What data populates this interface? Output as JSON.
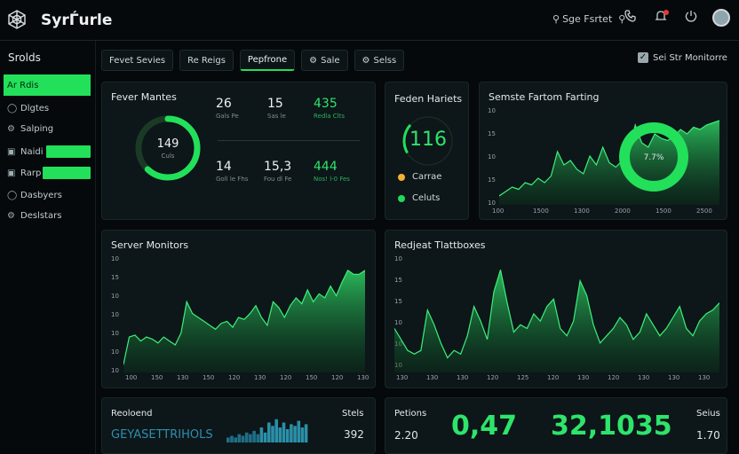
{
  "app": {
    "title": "SyrЃurle"
  },
  "search": {
    "label": "Sge Fsrtet"
  },
  "top_icons": [
    "search-icon",
    "phone-icon",
    "notification-icon",
    "power-icon",
    "avatar"
  ],
  "sidebar": {
    "title": "Srolds",
    "items": [
      {
        "label": "Ar Rdis",
        "icon": "",
        "active": true
      },
      {
        "label": "Dlgtes",
        "icon": "user-icon"
      },
      {
        "label": "Salping",
        "icon": "gear-icon"
      },
      {
        "label": "Naidi",
        "icon": "folder-icon"
      },
      {
        "label": "Rarp",
        "icon": "folder-icon"
      },
      {
        "label": "Dasbyers",
        "icon": "user-icon"
      },
      {
        "label": "Deslstars",
        "icon": "gear-icon"
      }
    ]
  },
  "tabs": [
    {
      "label": "Fevet Sevies"
    },
    {
      "label": "Re Reigs"
    },
    {
      "label": "Pepfrone",
      "active": true
    },
    {
      "label": "Sale",
      "icon": "gear-icon"
    },
    {
      "label": "Selss",
      "icon": "gear-icon"
    }
  ],
  "toggle": {
    "label": "Sei Str Monitorre",
    "checked": true
  },
  "card_fever": {
    "title": "Fever Mantes",
    "ring_value": "149",
    "ring_label": "Culs",
    "ring_fraction": 0.62,
    "stats": [
      {
        "value": "26",
        "label": "Gals Pe",
        "green": false
      },
      {
        "value": "15",
        "label": "Sas le",
        "green": false
      },
      {
        "value": "435",
        "label": "Redla Clts",
        "green": true
      },
      {
        "value": "14",
        "label": "Goll le Fhs",
        "green": false
      },
      {
        "value": "15,3",
        "label": "Fou dl Fe",
        "green": false
      },
      {
        "value": "444",
        "label": "Nos! l-0 Fes",
        "green": true
      }
    ]
  },
  "card_feden": {
    "title": "Feden Hariets",
    "ring_value": "116",
    "ring_fraction": 0.2,
    "legend": [
      {
        "label": "Carrae",
        "color": "#f2b233"
      },
      {
        "label": "Celuts",
        "color": "#22d860"
      }
    ]
  },
  "charts": {
    "semste": {
      "title": "Semste Fartom Farting",
      "ring_label": "7.7%",
      "y_ticks": [
        "10",
        "15",
        "10",
        "15",
        "10"
      ],
      "x_ticks": [
        "100",
        "1500",
        "1300",
        "2000",
        "1500",
        "2500"
      ]
    },
    "server": {
      "title": "Server Monitors",
      "y_ticks": [
        "10",
        "15",
        "10",
        "10",
        "10",
        "10",
        "10"
      ],
      "x_ticks": [
        "100",
        "150",
        "130",
        "150",
        "120",
        "130",
        "120",
        "150",
        "120",
        "130"
      ]
    },
    "redjeat": {
      "title": "Redjeat Tlattboxes",
      "y_ticks": [
        "10",
        "15",
        "15",
        "10",
        "10",
        "10"
      ],
      "x_ticks": [
        "130",
        "130",
        "130",
        "120",
        "125",
        "120",
        "130",
        "120",
        "130",
        "130",
        "130"
      ]
    }
  },
  "chart_data": [
    {
      "type": "area",
      "title": "Semste Fartom Farting",
      "x": [
        0,
        1,
        2,
        3,
        4,
        5,
        6,
        7,
        8,
        9,
        10,
        11,
        12,
        13,
        14,
        15,
        16,
        17,
        18,
        19,
        20,
        21,
        22,
        23,
        24,
        25,
        26,
        27,
        28,
        29,
        30,
        31,
        32,
        33,
        34
      ],
      "values": [
        2,
        3,
        4,
        3.5,
        5,
        4.5,
        6,
        5,
        6.5,
        12,
        9,
        10,
        8,
        7,
        11,
        9,
        13,
        9.5,
        8.5,
        10,
        11.5,
        18,
        14,
        13,
        16,
        15,
        14.5,
        15.5,
        17,
        16,
        17.5,
        17,
        18,
        18.5,
        19
      ],
      "ylim": [
        0,
        22
      ]
    },
    {
      "type": "area",
      "title": "Server Monitors",
      "values": [
        2,
        9,
        9.5,
        8,
        9,
        8.5,
        7.5,
        9,
        8,
        7,
        10,
        18,
        15,
        14,
        13,
        12,
        11,
        12.5,
        13,
        11.5,
        14,
        13.5,
        15,
        17,
        14,
        12,
        18,
        16.5,
        14,
        17,
        19,
        17.5,
        21,
        18,
        20,
        19,
        22,
        19.5,
        23,
        26,
        25,
        25,
        26
      ],
      "ylim": [
        0,
        28
      ]
    },
    {
      "type": "area",
      "title": "Redjeat Tlattboxes",
      "values": [
        12,
        9,
        6,
        5,
        6,
        17,
        13,
        8,
        4,
        6,
        5,
        10,
        18,
        14,
        9,
        22,
        28,
        19,
        11,
        13,
        12,
        16,
        14,
        18,
        20,
        12,
        10,
        14,
        25,
        21,
        13,
        8,
        10,
        12,
        15,
        13,
        9,
        11,
        16,
        13,
        10,
        12,
        15,
        18,
        12,
        10,
        14,
        16,
        17,
        19
      ],
      "ylim": [
        0,
        30
      ]
    },
    {
      "type": "bar",
      "title": "Reoloend",
      "values": [
        3,
        4,
        3,
        5,
        4,
        6,
        5,
        7,
        5,
        9,
        6,
        12,
        10,
        14,
        9,
        12,
        8,
        11,
        10,
        13,
        9,
        11
      ],
      "ylim": [
        0,
        16
      ]
    }
  ],
  "bottom_left": {
    "title": "Reoloend",
    "right_label": "Stels",
    "text": "GEYASETTRIHOLS",
    "value": "392"
  },
  "bottom_right": {
    "title": "Petions",
    "right_label": "Seius",
    "left_small": "2.20",
    "big1": "0,47",
    "big2": "32,1035",
    "right_small": "1.70"
  },
  "colors": {
    "accent": "#22e05a",
    "bg": "#05090b",
    "card": "#0d1619"
  }
}
